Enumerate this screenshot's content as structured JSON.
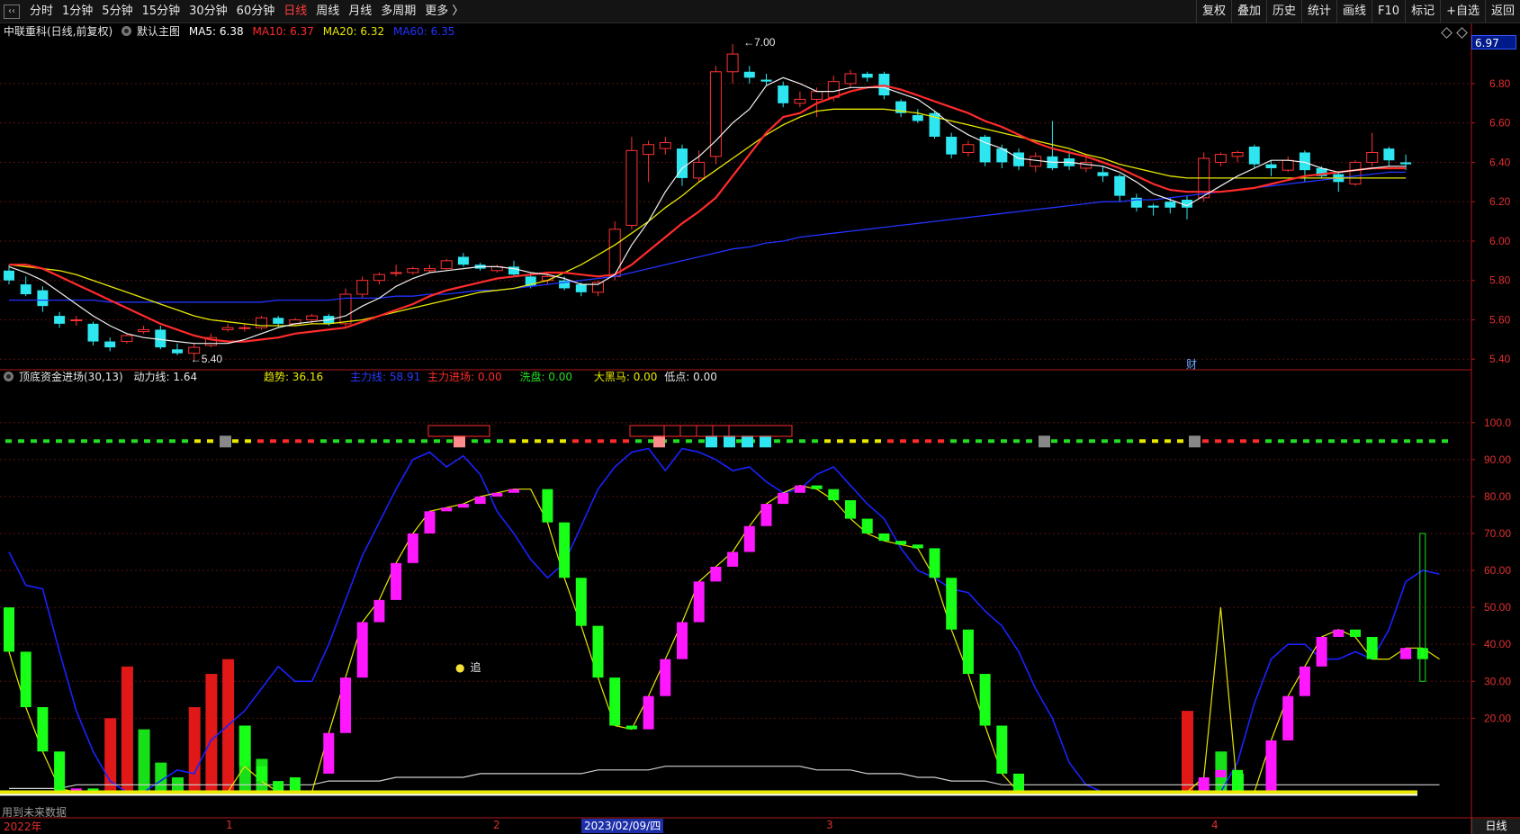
{
  "toolbar": {
    "back_icon": "left-chevron-icon",
    "periods": [
      "分时",
      "1分钟",
      "5分钟",
      "15分钟",
      "30分钟",
      "60分钟",
      "日线",
      "周线",
      "月线",
      "多周期",
      "更多 〉"
    ],
    "active_period": "日线",
    "right_buttons": [
      "复权",
      "叠加",
      "历史",
      "统计",
      "画线",
      "F10",
      "标记",
      "+自选",
      "返回"
    ]
  },
  "main_chart": {
    "stock_title": "中联重科(日线,前复权)",
    "indicator_name": "默认主图",
    "ma": [
      {
        "label": "MA5: 6.38",
        "color": "#ffffff"
      },
      {
        "label": "MA10: 6.37",
        "color": "#ff2b2b"
      },
      {
        "label": "MA20: 6.32",
        "color": "#e8e800"
      },
      {
        "label": "MA60: 6.35",
        "color": "#2233ff"
      }
    ],
    "current_price": "6.97",
    "high_marker": "7.00",
    "low_marker": "5.40",
    "finance_mark": "财"
  },
  "sub_chart": {
    "indicator_name": "顶底资金进场(30,13)",
    "legend": [
      {
        "label": "动力线: 1.64",
        "color": "#e6e6e6"
      },
      {
        "label": "趋势: 36.16",
        "color": "#e8e800"
      },
      {
        "label": "主力线: 58.91",
        "color": "#2b3bff"
      },
      {
        "label": "主力进场: 0.00",
        "color": "#ff2b2b"
      },
      {
        "label": "洗盘: 0.00",
        "color": "#22dd22"
      },
      {
        "label": "大黑马: 0.00",
        "color": "#e8e800"
      },
      {
        "label": "低点: 0.00",
        "color": "#e6e6e6"
      }
    ],
    "chase_label": "追",
    "note": "用到未来数据"
  },
  "bottom_axis": {
    "labels": [
      "2022年",
      "1",
      "2",
      "2023/02/09/四",
      "3",
      "4"
    ],
    "highlight": "2023/02/09/四",
    "period_tab": "日线"
  },
  "chart_data": {
    "type": "candlestick",
    "price_axis": {
      "ticks": [
        "6.80",
        "6.60",
        "6.40",
        "6.20",
        "6.00",
        "5.80",
        "5.60",
        "5.40"
      ],
      "ylim": [
        5.36,
        7.06
      ]
    },
    "candles": [
      [
        5.85,
        5.8,
        5.88,
        5.78
      ],
      [
        5.78,
        5.73,
        5.82,
        5.72
      ],
      [
        5.75,
        5.67,
        5.77,
        5.64
      ],
      [
        5.62,
        5.58,
        5.64,
        5.56
      ],
      [
        5.6,
        5.6,
        5.62,
        5.57
      ],
      [
        5.58,
        5.49,
        5.59,
        5.47
      ],
      [
        5.49,
        5.46,
        5.51,
        5.44
      ],
      [
        5.49,
        5.52,
        5.53,
        5.48
      ],
      [
        5.54,
        5.55,
        5.57,
        5.53
      ],
      [
        5.55,
        5.46,
        5.57,
        5.45
      ],
      [
        5.45,
        5.43,
        5.48,
        5.42
      ],
      [
        5.43,
        5.46,
        5.48,
        5.4
      ],
      [
        5.47,
        5.51,
        5.53,
        5.46
      ],
      [
        5.55,
        5.56,
        5.58,
        5.54
      ],
      [
        5.56,
        5.56,
        5.58,
        5.54
      ],
      [
        5.56,
        5.61,
        5.62,
        5.55
      ],
      [
        5.61,
        5.58,
        5.62,
        5.56
      ],
      [
        5.58,
        5.6,
        5.61,
        5.57
      ],
      [
        5.6,
        5.62,
        5.63,
        5.58
      ],
      [
        5.62,
        5.58,
        5.63,
        5.57
      ],
      [
        5.58,
        5.73,
        5.76,
        5.56
      ],
      [
        5.73,
        5.8,
        5.82,
        5.71
      ],
      [
        5.8,
        5.83,
        5.84,
        5.78
      ],
      [
        5.84,
        5.84,
        5.88,
        5.82
      ],
      [
        5.84,
        5.86,
        5.87,
        5.83
      ],
      [
        5.85,
        5.86,
        5.88,
        5.84
      ],
      [
        5.86,
        5.9,
        5.91,
        5.85
      ],
      [
        5.92,
        5.88,
        5.94,
        5.87
      ],
      [
        5.88,
        5.86,
        5.89,
        5.85
      ],
      [
        5.85,
        5.87,
        5.88,
        5.84
      ],
      [
        5.87,
        5.83,
        5.9,
        5.82
      ],
      [
        5.82,
        5.77,
        5.84,
        5.76
      ],
      [
        5.8,
        5.82,
        5.84,
        5.78
      ],
      [
        5.8,
        5.76,
        5.82,
        5.75
      ],
      [
        5.78,
        5.74,
        5.79,
        5.72
      ],
      [
        5.74,
        5.79,
        5.8,
        5.72
      ],
      [
        5.82,
        6.06,
        6.1,
        5.8
      ],
      [
        6.08,
        6.46,
        6.53,
        6.06
      ],
      [
        6.44,
        6.49,
        6.51,
        6.3
      ],
      [
        6.47,
        6.5,
        6.53,
        6.44
      ],
      [
        6.47,
        6.32,
        6.49,
        6.28
      ],
      [
        6.32,
        6.4,
        6.46,
        6.3
      ],
      [
        6.43,
        6.86,
        6.89,
        6.39
      ],
      [
        6.86,
        6.95,
        7.0,
        6.8
      ],
      [
        6.86,
        6.83,
        6.89,
        6.8
      ],
      [
        6.82,
        6.81,
        6.85,
        6.79
      ],
      [
        6.79,
        6.7,
        6.81,
        6.68
      ],
      [
        6.7,
        6.72,
        6.76,
        6.68
      ],
      [
        6.72,
        6.76,
        6.78,
        6.63
      ],
      [
        6.73,
        6.81,
        6.84,
        6.71
      ],
      [
        6.8,
        6.85,
        6.87,
        6.78
      ],
      [
        6.85,
        6.83,
        6.86,
        6.81
      ],
      [
        6.85,
        6.74,
        6.86,
        6.72
      ],
      [
        6.71,
        6.65,
        6.72,
        6.63
      ],
      [
        6.64,
        6.61,
        6.67,
        6.6
      ],
      [
        6.65,
        6.53,
        6.66,
        6.52
      ],
      [
        6.53,
        6.44,
        6.55,
        6.42
      ],
      [
        6.45,
        6.49,
        6.51,
        6.43
      ],
      [
        6.53,
        6.4,
        6.54,
        6.38
      ],
      [
        6.47,
        6.4,
        6.49,
        6.37
      ],
      [
        6.45,
        6.38,
        6.47,
        6.36
      ],
      [
        6.38,
        6.43,
        6.45,
        6.35
      ],
      [
        6.43,
        6.37,
        6.61,
        6.36
      ],
      [
        6.42,
        6.38,
        6.46,
        6.36
      ],
      [
        6.37,
        6.4,
        6.44,
        6.35
      ],
      [
        6.35,
        6.33,
        6.38,
        6.3
      ],
      [
        6.33,
        6.23,
        6.34,
        6.2
      ],
      [
        6.22,
        6.17,
        6.24,
        6.15
      ],
      [
        6.18,
        6.17,
        6.19,
        6.13
      ],
      [
        6.2,
        6.17,
        6.22,
        6.14
      ],
      [
        6.21,
        6.17,
        6.23,
        6.11
      ],
      [
        6.22,
        6.42,
        6.45,
        6.2
      ],
      [
        6.4,
        6.44,
        6.45,
        6.38
      ],
      [
        6.43,
        6.45,
        6.46,
        6.4
      ],
      [
        6.48,
        6.39,
        6.49,
        6.37
      ],
      [
        6.39,
        6.37,
        6.41,
        6.33
      ],
      [
        6.36,
        6.41,
        6.43,
        6.35
      ],
      [
        6.45,
        6.36,
        6.46,
        6.3
      ],
      [
        6.37,
        6.33,
        6.38,
        6.32
      ],
      [
        6.34,
        6.3,
        6.35,
        6.25
      ],
      [
        6.29,
        6.4,
        6.41,
        6.28
      ],
      [
        6.4,
        6.45,
        6.55,
        6.38
      ],
      [
        6.47,
        6.41,
        6.48,
        6.38
      ],
      [
        6.4,
        6.39,
        6.44,
        6.36
      ]
    ],
    "ma5": [
      5.87,
      5.84,
      5.8,
      5.74,
      5.68,
      5.62,
      5.57,
      5.53,
      5.51,
      5.5,
      5.49,
      5.48,
      5.48,
      5.48,
      5.5,
      5.53,
      5.56,
      5.58,
      5.59,
      5.6,
      5.62,
      5.67,
      5.71,
      5.77,
      5.81,
      5.84,
      5.85,
      5.86,
      5.87,
      5.87,
      5.86,
      5.84,
      5.83,
      5.81,
      5.78,
      5.78,
      5.83,
      5.98,
      6.1,
      6.25,
      6.37,
      6.43,
      6.51,
      6.6,
      6.67,
      6.79,
      6.83,
      6.8,
      6.76,
      6.76,
      6.78,
      6.78,
      6.78,
      6.75,
      6.72,
      6.66,
      6.59,
      6.54,
      6.5,
      6.47,
      6.42,
      6.41,
      6.4,
      6.4,
      6.39,
      6.38,
      6.35,
      6.3,
      6.24,
      6.21,
      6.18,
      6.23,
      6.28,
      6.33,
      6.37,
      6.41,
      6.41,
      6.4,
      6.37,
      6.35,
      6.36,
      6.37,
      6.38,
      6.38
    ],
    "ma10": [
      5.88,
      5.88,
      5.86,
      5.82,
      5.78,
      5.74,
      5.7,
      5.66,
      5.62,
      5.58,
      5.55,
      5.52,
      5.5,
      5.49,
      5.49,
      5.5,
      5.51,
      5.53,
      5.54,
      5.55,
      5.56,
      5.59,
      5.62,
      5.65,
      5.68,
      5.72,
      5.75,
      5.77,
      5.79,
      5.81,
      5.82,
      5.83,
      5.84,
      5.84,
      5.83,
      5.82,
      5.83,
      5.88,
      5.95,
      6.02,
      6.09,
      6.15,
      6.22,
      6.33,
      6.44,
      6.55,
      6.63,
      6.65,
      6.7,
      6.73,
      6.76,
      6.78,
      6.79,
      6.77,
      6.74,
      6.71,
      6.68,
      6.65,
      6.61,
      6.58,
      6.54,
      6.5,
      6.47,
      6.45,
      6.43,
      6.4,
      6.37,
      6.33,
      6.29,
      6.26,
      6.25,
      6.25,
      6.25,
      6.26,
      6.27,
      6.29,
      6.31,
      6.33,
      6.34,
      6.35,
      6.36,
      6.37,
      6.37,
      6.37
    ],
    "ma20": [
      5.88,
      5.87,
      5.86,
      5.85,
      5.83,
      5.8,
      5.77,
      5.74,
      5.71,
      5.68,
      5.65,
      5.62,
      5.6,
      5.59,
      5.58,
      5.57,
      5.57,
      5.57,
      5.58,
      5.58,
      5.59,
      5.6,
      5.62,
      5.64,
      5.66,
      5.68,
      5.7,
      5.72,
      5.74,
      5.75,
      5.76,
      5.78,
      5.8,
      5.84,
      5.88,
      5.93,
      5.98,
      6.04,
      6.1,
      6.17,
      6.23,
      6.3,
      6.36,
      6.42,
      6.48,
      6.54,
      6.59,
      6.63,
      6.66,
      6.67,
      6.67,
      6.67,
      6.67,
      6.66,
      6.65,
      6.63,
      6.61,
      6.59,
      6.57,
      6.55,
      6.53,
      6.51,
      6.49,
      6.47,
      6.44,
      6.42,
      6.39,
      6.37,
      6.35,
      6.33,
      6.32,
      6.32,
      6.32,
      6.32,
      6.32,
      6.32,
      6.32,
      6.32,
      6.32,
      6.32,
      6.32,
      6.32,
      6.32,
      6.32
    ],
    "ma60": [
      5.7,
      5.7,
      5.7,
      5.7,
      5.7,
      5.7,
      5.69,
      5.69,
      5.69,
      5.69,
      5.69,
      5.69,
      5.69,
      5.69,
      5.69,
      5.69,
      5.7,
      5.7,
      5.7,
      5.7,
      5.71,
      5.71,
      5.71,
      5.72,
      5.72,
      5.73,
      5.73,
      5.74,
      5.75,
      5.75,
      5.76,
      5.77,
      5.78,
      5.79,
      5.8,
      5.81,
      5.82,
      5.84,
      5.86,
      5.88,
      5.9,
      5.92,
      5.94,
      5.96,
      5.97,
      5.99,
      6.0,
      6.02,
      6.03,
      6.04,
      6.05,
      6.06,
      6.07,
      6.08,
      6.09,
      6.1,
      6.11,
      6.12,
      6.13,
      6.14,
      6.15,
      6.16,
      6.17,
      6.18,
      6.19,
      6.2,
      6.2,
      6.21,
      6.21,
      6.22,
      6.23,
      6.24,
      6.25,
      6.26,
      6.27,
      6.28,
      6.29,
      6.3,
      6.31,
      6.32,
      6.33,
      6.34,
      6.35,
      6.35
    ],
    "sub_axis": {
      "ticks": [
        "100.0",
        "90.00",
        "80.00",
        "70.00",
        "60.00",
        "50.00",
        "40.00",
        "30.00",
        "20.00"
      ],
      "ylim": [
        -5,
        107
      ]
    },
    "trend_bars": [
      [
        50,
        38
      ],
      [
        38,
        23
      ],
      [
        23,
        11
      ],
      [
        11,
        0
      ],
      [
        0,
        1
      ],
      [
        1,
        0
      ],
      [
        0,
        0
      ],
      [
        0,
        0
      ],
      [
        0,
        0
      ],
      [
        0,
        0
      ],
      [
        0,
        0
      ],
      [
        0,
        0
      ],
      [
        0,
        0
      ],
      [
        0,
        0
      ],
      [
        18,
        7
      ],
      [
        7,
        3
      ],
      [
        3,
        0
      ],
      [
        4,
        0
      ],
      [
        0,
        0
      ],
      [
        5,
        16
      ],
      [
        16,
        31
      ],
      [
        31,
        46
      ],
      [
        46,
        52
      ],
      [
        52,
        62
      ],
      [
        62,
        70
      ],
      [
        70,
        76
      ],
      [
        76,
        77
      ],
      [
        77,
        78
      ],
      [
        78,
        80
      ],
      [
        80,
        81
      ],
      [
        81,
        82
      ],
      [
        82,
        82
      ],
      [
        82,
        73
      ],
      [
        73,
        58
      ],
      [
        58,
        45
      ],
      [
        45,
        31
      ],
      [
        31,
        18
      ],
      [
        18,
        17
      ],
      [
        17,
        26
      ],
      [
        26,
        36
      ],
      [
        36,
        46
      ],
      [
        46,
        57
      ],
      [
        57,
        61
      ],
      [
        61,
        65
      ],
      [
        65,
        72
      ],
      [
        72,
        78
      ],
      [
        78,
        81
      ],
      [
        81,
        83
      ],
      [
        83,
        82
      ],
      [
        82,
        79
      ],
      [
        79,
        74
      ],
      [
        74,
        70
      ],
      [
        70,
        68
      ],
      [
        68,
        67
      ],
      [
        67,
        66
      ],
      [
        66,
        58
      ],
      [
        58,
        44
      ],
      [
        44,
        32
      ],
      [
        32,
        18
      ],
      [
        18,
        5
      ],
      [
        5,
        0
      ],
      [
        0,
        0
      ],
      [
        0,
        0
      ],
      [
        0,
        0
      ],
      [
        0,
        0
      ],
      [
        0,
        0
      ],
      [
        0,
        0
      ],
      [
        0,
        0
      ],
      [
        0,
        0
      ],
      [
        0,
        0
      ],
      [
        0,
        0
      ],
      [
        0,
        4
      ],
      [
        4,
        6
      ],
      [
        6,
        0
      ],
      [
        0,
        0
      ],
      [
        0,
        14
      ],
      [
        14,
        26
      ],
      [
        26,
        34
      ],
      [
        34,
        42
      ],
      [
        42,
        44
      ],
      [
        44,
        42
      ],
      [
        42,
        36
      ],
      [
        36,
        36
      ],
      [
        36,
        39
      ],
      [
        39,
        36
      ]
    ],
    "main_line": [
      65,
      56,
      55,
      38,
      22,
      11,
      3,
      0,
      0,
      3,
      6,
      5,
      14,
      18,
      22,
      28,
      34,
      30,
      30,
      40,
      52,
      64,
      73,
      82,
      90,
      92,
      88,
      91,
      86,
      76,
      70,
      63,
      58,
      62,
      72,
      82,
      88,
      92,
      93,
      87,
      93,
      92,
      90,
      87,
      88,
      84,
      81,
      82,
      86,
      88,
      83,
      78,
      74,
      66,
      60,
      58,
      55,
      54,
      49,
      45,
      38,
      28,
      20,
      8,
      2,
      0,
      0,
      0,
      0,
      0,
      0,
      0,
      0,
      8,
      24,
      36,
      40,
      40,
      36,
      36,
      38,
      36,
      44,
      57,
      60,
      59
    ],
    "trend_line": [
      38,
      23,
      11,
      1,
      0,
      0,
      0,
      0,
      0,
      0,
      0,
      0,
      0,
      0,
      7,
      3,
      0,
      0,
      0,
      16,
      31,
      46,
      52,
      62,
      70,
      76,
      77,
      78,
      80,
      81,
      82,
      82,
      73,
      58,
      45,
      31,
      18,
      17,
      26,
      36,
      46,
      57,
      61,
      65,
      72,
      78,
      81,
      83,
      82,
      79,
      74,
      70,
      68,
      67,
      66,
      58,
      44,
      32,
      18,
      5,
      0,
      0,
      0,
      0,
      0,
      0,
      0,
      0,
      0,
      0,
      0,
      4,
      50,
      0,
      0,
      14,
      26,
      34,
      42,
      44,
      42,
      36,
      36,
      39,
      39,
      36
    ],
    "red_bars": [
      [
        6,
        20
      ],
      [
        7,
        34
      ],
      [
        11,
        23
      ],
      [
        12,
        32
      ],
      [
        13,
        36
      ],
      [
        70,
        22
      ]
    ],
    "green_bars": [
      [
        8,
        17
      ],
      [
        9,
        8
      ],
      [
        10,
        4
      ],
      [
        14,
        18
      ],
      [
        15,
        9
      ],
      [
        72,
        11
      ],
      [
        73,
        5
      ]
    ],
    "power_line": [
      1,
      1,
      1,
      1,
      2,
      2,
      2,
      2,
      2,
      2,
      2,
      2,
      2,
      2,
      2,
      2,
      2,
      2,
      2,
      3,
      3,
      3,
      3,
      4,
      4,
      4,
      4,
      4,
      5,
      5,
      5,
      5,
      5,
      5,
      5,
      6,
      6,
      6,
      6,
      7,
      7,
      7,
      7,
      7,
      7,
      7,
      7,
      7,
      6,
      6,
      6,
      5,
      5,
      5,
      4,
      4,
      3,
      3,
      3,
      2,
      2,
      2,
      2,
      2,
      2,
      2,
      2,
      2,
      2,
      2,
      2,
      2,
      2,
      2,
      2,
      2,
      2,
      2,
      2,
      2,
      2,
      2,
      2,
      2,
      2,
      2
    ]
  }
}
